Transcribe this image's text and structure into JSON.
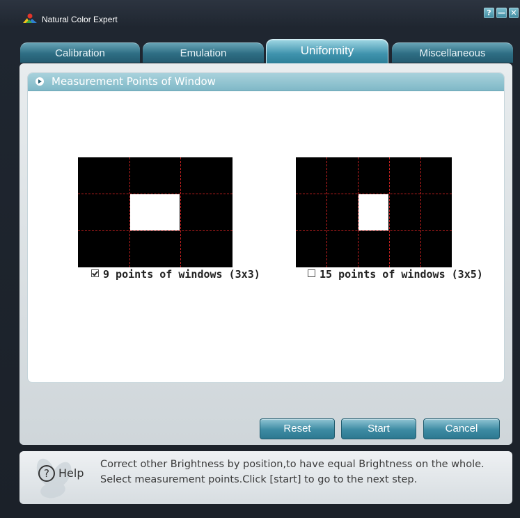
{
  "app": {
    "title": "Natural Color Expert",
    "controls": [
      "?",
      "—",
      "✕"
    ]
  },
  "tabs": [
    {
      "label": "Calibration",
      "active": false
    },
    {
      "label": "Emulation",
      "active": false
    },
    {
      "label": "Uniformity",
      "active": true
    },
    {
      "label": "Miscellaneous",
      "active": false
    }
  ],
  "section": {
    "title": "Measurement Points of Window"
  },
  "options": [
    {
      "label": "9 points of windows (3x3)",
      "checked": true
    },
    {
      "label": "15 points of windows (3x5)",
      "checked": false
    }
  ],
  "buttons": {
    "reset": "Reset",
    "start": "Start",
    "cancel": "Cancel"
  },
  "help": {
    "label": "Help",
    "text": "Correct other Brightness by position,to have equal Brightness on the whole. Select measurement points.Click [start] to go to the next step."
  },
  "colors": {
    "accent": "#3d8ba3",
    "grid_line": "#c21f1f",
    "grid_bg": "#000000"
  }
}
